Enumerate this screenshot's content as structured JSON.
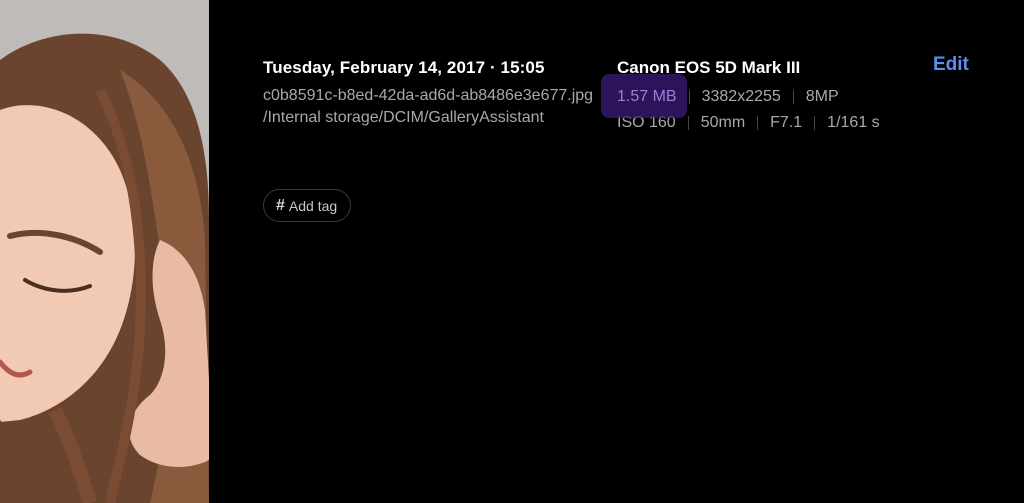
{
  "details": {
    "datetime": "Tuesday, February 14, 2017 · 15:05",
    "filename": "c0b8591c-b8ed-42da-ad6d-ab8486e3e677.jpg",
    "path": "/Internal storage/DCIM/GalleryAssistant",
    "add_tag_label": "Add tag",
    "add_tag_icon": "#"
  },
  "camera": {
    "model": "Canon EOS 5D Mark III",
    "file_size": "1.57 MB",
    "resolution": "3382x2255",
    "megapixels": "8MP",
    "iso": "ISO 160",
    "focal_length": "50mm",
    "aperture": "F7.1",
    "shutter": "1/161 s"
  },
  "actions": {
    "edit_label": "Edit"
  },
  "colors": {
    "background": "#000000",
    "accent": "#5b8ef0",
    "highlight": "#3b1a78"
  }
}
